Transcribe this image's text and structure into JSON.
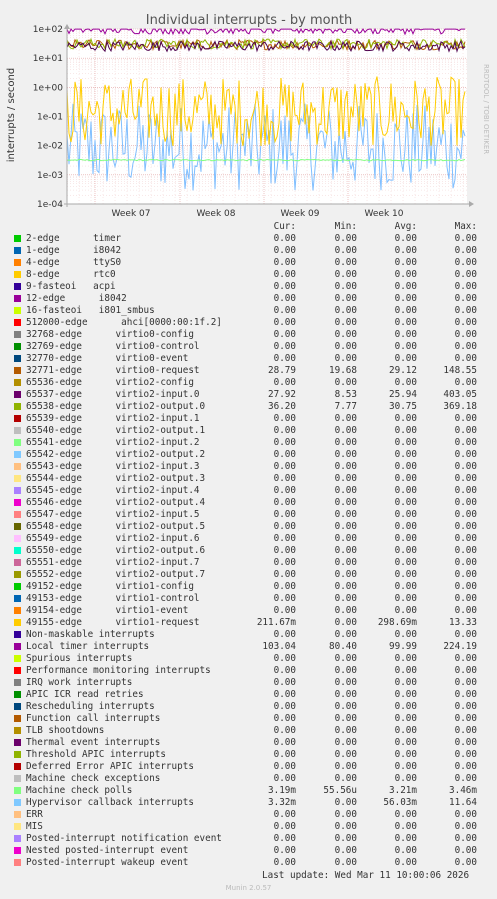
{
  "chart_data": {
    "type": "line",
    "title": "Individual interrupts - by month",
    "ylabel": "interrupts / second",
    "yscale": "log",
    "ylim": [
      0.0001,
      100
    ],
    "yticks": [
      "1e+02",
      "1e+01",
      "1e+00",
      "1e-01",
      "1e-02",
      "1e-03",
      "1e-04"
    ],
    "xticks": [
      "Week 07",
      "Week 08",
      "Week 09",
      "Week 10"
    ],
    "watermark": "RRDTOOL / TOBI OETIKER",
    "background": "#ffffff",
    "series": [
      {
        "name": "Local timer interrupts",
        "color": "#990099",
        "mean": 99.99,
        "min": 80.4,
        "max": 224.19
      },
      {
        "name": "65537-edge virtio2-input.0",
        "color": "#4d004d",
        "mean": 25.94,
        "min": 8.53,
        "max": 403.05
      },
      {
        "name": "65538-edge virtio2-output.0",
        "color": "#8fb300",
        "mean": 30.75,
        "min": 7.77,
        "max": 369.18
      },
      {
        "name": "32771-edge virtio0-request",
        "color": "#b35a00",
        "mean": 29.12,
        "min": 19.68,
        "max": 148.55
      },
      {
        "name": "49155-edge virtio1-request",
        "color": "#ffcc00",
        "mean": 0.29869,
        "min": 0,
        "max": 13.33
      },
      {
        "name": "Hypervisor callback interrupts",
        "color": "#80bfff",
        "mean": 0.05603,
        "min": 0,
        "max": 11.64
      },
      {
        "name": "Machine check polls",
        "color": "#80ff80",
        "mean": 0.00321,
        "min": 5.556e-05,
        "max": 0.00346
      }
    ]
  },
  "legend": {
    "headers": [
      "Cur:",
      "Min:",
      "Avg:",
      "Max:"
    ],
    "rows": [
      {
        "color": "#00cc00",
        "name": "2-edge      timer",
        "cur": "0.00",
        "min": "0.00",
        "avg": "0.00",
        "max": "0.00"
      },
      {
        "color": "#0066b3",
        "name": "1-edge      i8042",
        "cur": "0.00",
        "min": "0.00",
        "avg": "0.00",
        "max": "0.00"
      },
      {
        "color": "#ff8000",
        "name": "4-edge      ttyS0",
        "cur": "0.00",
        "min": "0.00",
        "avg": "0.00",
        "max": "0.00"
      },
      {
        "color": "#ffcc00",
        "name": "8-edge      rtc0",
        "cur": "0.00",
        "min": "0.00",
        "avg": "0.00",
        "max": "0.00"
      },
      {
        "color": "#330099",
        "name": "9-fasteoi   acpi",
        "cur": "0.00",
        "min": "0.00",
        "avg": "0.00",
        "max": "0.00"
      },
      {
        "color": "#990099",
        "name": "12-edge      i8042",
        "cur": "0.00",
        "min": "0.00",
        "avg": "0.00",
        "max": "0.00"
      },
      {
        "color": "#ccff00",
        "name": "16-fasteoi   i801_smbus",
        "cur": "0.00",
        "min": "0.00",
        "avg": "0.00",
        "max": "0.00"
      },
      {
        "color": "#ff0000",
        "name": "512000-edge      ahci[0000:00:1f.2]",
        "cur": "0.00",
        "min": "0.00",
        "avg": "0.00",
        "max": "0.00"
      },
      {
        "color": "#808080",
        "name": "32768-edge      virtio0-config",
        "cur": "0.00",
        "min": "0.00",
        "avg": "0.00",
        "max": "0.00"
      },
      {
        "color": "#008f00",
        "name": "32769-edge      virtio0-control",
        "cur": "0.00",
        "min": "0.00",
        "avg": "0.00",
        "max": "0.00"
      },
      {
        "color": "#00487d",
        "name": "32770-edge      virtio0-event",
        "cur": "0.00",
        "min": "0.00",
        "avg": "0.00",
        "max": "0.00"
      },
      {
        "color": "#b35a00",
        "name": "32771-edge      virtio0-request",
        "cur": "28.79",
        "min": "19.68",
        "avg": "29.12",
        "max": "148.55"
      },
      {
        "color": "#b38f00",
        "name": "65536-edge      virtio2-config",
        "cur": "0.00",
        "min": "0.00",
        "avg": "0.00",
        "max": "0.00"
      },
      {
        "color": "#6b006b",
        "name": "65537-edge      virtio2-input.0",
        "cur": "27.92",
        "min": "8.53",
        "avg": "25.94",
        "max": "403.05"
      },
      {
        "color": "#8fb300",
        "name": "65538-edge      virtio2-output.0",
        "cur": "36.20",
        "min": "7.77",
        "avg": "30.75",
        "max": "369.18"
      },
      {
        "color": "#b30000",
        "name": "65539-edge      virtio2-input.1",
        "cur": "0.00",
        "min": "0.00",
        "avg": "0.00",
        "max": "0.00"
      },
      {
        "color": "#bebebe",
        "name": "65540-edge      virtio2-output.1",
        "cur": "0.00",
        "min": "0.00",
        "avg": "0.00",
        "max": "0.00"
      },
      {
        "color": "#80ff80",
        "name": "65541-edge      virtio2-input.2",
        "cur": "0.00",
        "min": "0.00",
        "avg": "0.00",
        "max": "0.00"
      },
      {
        "color": "#80c9ff",
        "name": "65542-edge      virtio2-output.2",
        "cur": "0.00",
        "min": "0.00",
        "avg": "0.00",
        "max": "0.00"
      },
      {
        "color": "#ffc080",
        "name": "65543-edge      virtio2-input.3",
        "cur": "0.00",
        "min": "0.00",
        "avg": "0.00",
        "max": "0.00"
      },
      {
        "color": "#ffe680",
        "name": "65544-edge      virtio2-output.3",
        "cur": "0.00",
        "min": "0.00",
        "avg": "0.00",
        "max": "0.00"
      },
      {
        "color": "#aa80ff",
        "name": "65545-edge      virtio2-input.4",
        "cur": "0.00",
        "min": "0.00",
        "avg": "0.00",
        "max": "0.00"
      },
      {
        "color": "#ee00cc",
        "name": "65546-edge      virtio2-output.4",
        "cur": "0.00",
        "min": "0.00",
        "avg": "0.00",
        "max": "0.00"
      },
      {
        "color": "#ff8080",
        "name": "65547-edge      virtio2-input.5",
        "cur": "0.00",
        "min": "0.00",
        "avg": "0.00",
        "max": "0.00"
      },
      {
        "color": "#666600",
        "name": "65548-edge      virtio2-output.5",
        "cur": "0.00",
        "min": "0.00",
        "avg": "0.00",
        "max": "0.00"
      },
      {
        "color": "#ffbfff",
        "name": "65549-edge      virtio2-input.6",
        "cur": "0.00",
        "min": "0.00",
        "avg": "0.00",
        "max": "0.00"
      },
      {
        "color": "#00ffcc",
        "name": "65550-edge      virtio2-output.6",
        "cur": "0.00",
        "min": "0.00",
        "avg": "0.00",
        "max": "0.00"
      },
      {
        "color": "#cc6699",
        "name": "65551-edge      virtio2-input.7",
        "cur": "0.00",
        "min": "0.00",
        "avg": "0.00",
        "max": "0.00"
      },
      {
        "color": "#999900",
        "name": "65552-edge      virtio2-output.7",
        "cur": "0.00",
        "min": "0.00",
        "avg": "0.00",
        "max": "0.00"
      },
      {
        "color": "#00cc00",
        "name": "49152-edge      virtio1-config",
        "cur": "0.00",
        "min": "0.00",
        "avg": "0.00",
        "max": "0.00"
      },
      {
        "color": "#0066b3",
        "name": "49153-edge      virtio1-control",
        "cur": "0.00",
        "min": "0.00",
        "avg": "0.00",
        "max": "0.00"
      },
      {
        "color": "#ff8000",
        "name": "49154-edge      virtio1-event",
        "cur": "0.00",
        "min": "0.00",
        "avg": "0.00",
        "max": "0.00"
      },
      {
        "color": "#ffcc00",
        "name": "49155-edge      virtio1-request",
        "cur": "211.67m",
        "min": "0.00",
        "avg": "298.69m",
        "max": "13.33"
      },
      {
        "color": "#330099",
        "name": "Non-maskable interrupts",
        "cur": "0.00",
        "min": "0.00",
        "avg": "0.00",
        "max": "0.00"
      },
      {
        "color": "#990099",
        "name": "Local timer interrupts",
        "cur": "103.04",
        "min": "80.40",
        "avg": "99.99",
        "max": "224.19"
      },
      {
        "color": "#ccff00",
        "name": "Spurious interrupts",
        "cur": "0.00",
        "min": "0.00",
        "avg": "0.00",
        "max": "0.00"
      },
      {
        "color": "#ff0000",
        "name": "Performance monitoring interrupts",
        "cur": "0.00",
        "min": "0.00",
        "avg": "0.00",
        "max": "0.00"
      },
      {
        "color": "#808080",
        "name": "IRQ work interrupts",
        "cur": "0.00",
        "min": "0.00",
        "avg": "0.00",
        "max": "0.00"
      },
      {
        "color": "#008f00",
        "name": "APIC ICR read retries",
        "cur": "0.00",
        "min": "0.00",
        "avg": "0.00",
        "max": "0.00"
      },
      {
        "color": "#00487d",
        "name": "Rescheduling interrupts",
        "cur": "0.00",
        "min": "0.00",
        "avg": "0.00",
        "max": "0.00"
      },
      {
        "color": "#b35a00",
        "name": "Function call interrupts",
        "cur": "0.00",
        "min": "0.00",
        "avg": "0.00",
        "max": "0.00"
      },
      {
        "color": "#b38f00",
        "name": "TLB shootdowns",
        "cur": "0.00",
        "min": "0.00",
        "avg": "0.00",
        "max": "0.00"
      },
      {
        "color": "#6b006b",
        "name": "Thermal event interrupts",
        "cur": "0.00",
        "min": "0.00",
        "avg": "0.00",
        "max": "0.00"
      },
      {
        "color": "#8fb300",
        "name": "Threshold APIC interrupts",
        "cur": "0.00",
        "min": "0.00",
        "avg": "0.00",
        "max": "0.00"
      },
      {
        "color": "#b30000",
        "name": "Deferred Error APIC interrupts",
        "cur": "0.00",
        "min": "0.00",
        "avg": "0.00",
        "max": "0.00"
      },
      {
        "color": "#bebebe",
        "name": "Machine check exceptions",
        "cur": "0.00",
        "min": "0.00",
        "avg": "0.00",
        "max": "0.00"
      },
      {
        "color": "#80ff80",
        "name": "Machine check polls",
        "cur": "3.19m",
        "min": "55.56u",
        "avg": "3.21m",
        "max": "3.46m"
      },
      {
        "color": "#80c9ff",
        "name": "Hypervisor callback interrupts",
        "cur": "3.32m",
        "min": "0.00",
        "avg": "56.03m",
        "max": "11.64"
      },
      {
        "color": "#ffc080",
        "name": "ERR",
        "cur": "0.00",
        "min": "0.00",
        "avg": "0.00",
        "max": "0.00"
      },
      {
        "color": "#ffe680",
        "name": "MIS",
        "cur": "0.00",
        "min": "0.00",
        "avg": "0.00",
        "max": "0.00"
      },
      {
        "color": "#aa80ff",
        "name": "Posted-interrupt notification event",
        "cur": "0.00",
        "min": "0.00",
        "avg": "0.00",
        "max": "0.00"
      },
      {
        "color": "#ee00cc",
        "name": "Nested posted-interrupt event",
        "cur": "0.00",
        "min": "0.00",
        "avg": "0.00",
        "max": "0.00"
      },
      {
        "color": "#ff8080",
        "name": "Posted-interrupt wakeup event",
        "cur": "0.00",
        "min": "0.00",
        "avg": "0.00",
        "max": "0.00"
      }
    ]
  },
  "footer": {
    "last_update": "Last update: Wed Mar 11 10:00:06 2026",
    "version": "Munin 2.0.57"
  }
}
